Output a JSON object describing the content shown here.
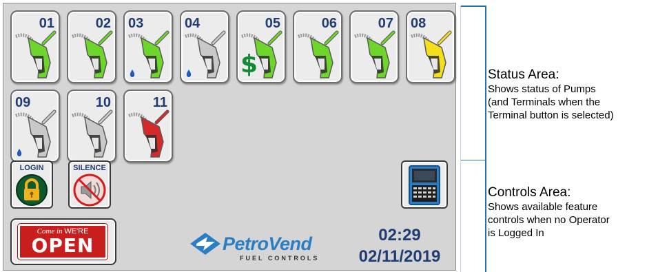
{
  "pumps": [
    {
      "number": "01",
      "color": "#6ed62a",
      "drip": false,
      "dollar": false
    },
    {
      "number": "02",
      "color": "#6ed62a",
      "drip": false,
      "dollar": false
    },
    {
      "number": "03",
      "color": "#6ed62a",
      "drip": true,
      "dollar": false
    },
    {
      "number": "04",
      "color": "#c9c9c9",
      "drip": true,
      "dollar": false
    },
    {
      "number": "05",
      "color": "#6ed62a",
      "drip": false,
      "dollar": true
    },
    {
      "number": "06",
      "color": "#6ed62a",
      "drip": false,
      "dollar": false
    },
    {
      "number": "07",
      "color": "#6ed62a",
      "drip": false,
      "dollar": false
    },
    {
      "number": "08",
      "color": "#f5df1a",
      "drip": false,
      "dollar": false
    },
    {
      "number": "09",
      "color": "#c9c9c9",
      "drip": true,
      "dollar": false
    },
    {
      "number": "10",
      "color": "#c9c9c9",
      "drip": false,
      "dollar": false
    },
    {
      "number": "11",
      "color": "#d42a2a",
      "drip": false,
      "dollar": false
    }
  ],
  "dollar_symbol": "$",
  "controls": {
    "login_label": "LOGIN",
    "silence_label": "SILENCE"
  },
  "open_sign": {
    "top_italic": "Come in",
    "top_plain": "WE'RE",
    "big": "OPEN"
  },
  "logo": {
    "name": "PetroVend",
    "sub": "FUEL CONTROLS"
  },
  "clock": {
    "time": "02:29",
    "date": "02/11/2019"
  },
  "annotations": {
    "status": {
      "title": "Status Area:",
      "lines": [
        "Shows status of Pumps",
        "(and Terminals when the",
        "Terminal button is selected)"
      ]
    },
    "controls": {
      "title": "Controls Area:",
      "lines": [
        "Shows available feature",
        "controls when no Operator",
        "is Logged In"
      ]
    }
  },
  "colors": {
    "accent": "#1f3c73",
    "brand": "#2a7fc4",
    "annotation_line": "#2b6db5"
  },
  "icons": [
    "fuel-nozzle-icon",
    "fuel-drip-icon",
    "dollar-icon",
    "padlock-icon",
    "muted-speaker-icon",
    "terminal-device-icon",
    "petrovend-logo-icon"
  ]
}
